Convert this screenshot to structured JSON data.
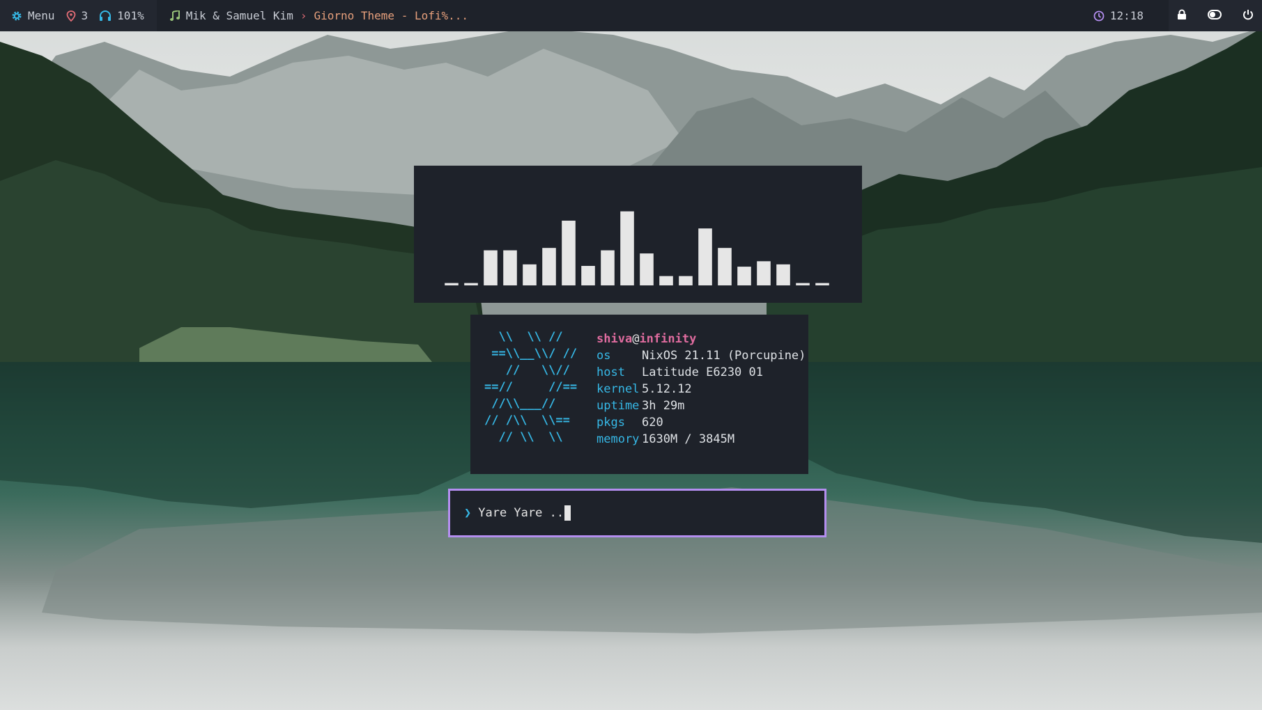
{
  "topbar": {
    "menu_label": "Menu",
    "workspace_count": "3",
    "volume_level": "101%",
    "music": {
      "artist": "Mik & Samuel Kim",
      "separator": "›",
      "title": "Giorno Theme - Lofi%..."
    },
    "clock": "12:18",
    "icons": {
      "menu": "gear-icon",
      "workspaces": "location-pin-icon",
      "volume": "headphones-icon",
      "music": "music-note-icon",
      "clock": "clock-icon",
      "lock": "lock-icon",
      "toggle": "toggle-icon",
      "power": "power-icon"
    }
  },
  "visualizer": {
    "levels": [
      0.03,
      0.03,
      0.45,
      0.45,
      0.27,
      0.48,
      0.83,
      0.25,
      0.45,
      0.95,
      0.41,
      0.12,
      0.12,
      0.73,
      0.48,
      0.24,
      0.31,
      0.27,
      0.03,
      0.03
    ],
    "bar_color": "#e6e6e6"
  },
  "neofetch": {
    "logo_lines": [
      "  \\\\  \\\\ //",
      " ==\\\\__\\\\/ //",
      "   //   \\\\//",
      "==//     //==",
      " //\\\\___//",
      "// /\\\\  \\\\==",
      "  // \\\\  \\\\"
    ],
    "user": "shiva",
    "at": "@",
    "hostname": "infinity",
    "rows": [
      {
        "key": "os",
        "value": "NixOS 21.11 (Porcupine)"
      },
      {
        "key": "host",
        "value": "Latitude E6230 01"
      },
      {
        "key": "kernel",
        "value": "5.12.12"
      },
      {
        "key": "uptime",
        "value": "3h 29m"
      },
      {
        "key": "pkgs",
        "value": "620"
      },
      {
        "key": "memory",
        "value": "1630M / 3845M"
      }
    ]
  },
  "prompt": {
    "symbol": "❯",
    "text": "Yare Yare .."
  },
  "colors": {
    "bar_bg": "#1e222a",
    "accent_blue": "#36b8e6",
    "accent_pink": "#e06c9f",
    "accent_orange": "#e7a07c",
    "prompt_border": "#b48ef0",
    "menu_icon": "#36b8e6",
    "pin_icon": "#e06c75",
    "headphone_icon": "#36b8e6",
    "music_icon": "#98c379",
    "clock_icon": "#b48ef0"
  }
}
